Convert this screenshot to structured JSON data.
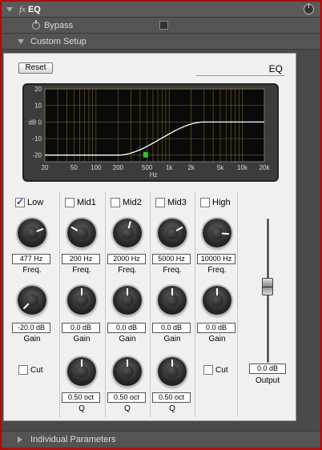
{
  "header": {
    "fx_label": "fx",
    "title": "EQ",
    "power_icon": "power-icon"
  },
  "bypass": {
    "label": "Bypass",
    "checked": false
  },
  "custom_setup": {
    "label": "Custom Setup"
  },
  "panel": {
    "reset_label": "Reset",
    "title": "EQ",
    "graph": {
      "y_ticks": [
        "20",
        "10",
        "dB 0",
        "-10",
        "-20"
      ],
      "x_ticks": [
        "20",
        "50",
        "100",
        "200",
        "500",
        "1k",
        "2k",
        "5k",
        "10k",
        "20k"
      ],
      "x_unit": "Hz",
      "curve_color": "#ffffff",
      "grid_color": "#8a6a2a",
      "handle_color": "#22cc22"
    },
    "bands": [
      {
        "id": "low",
        "label": "Low",
        "checked": true,
        "freq": "477 Hz",
        "freq_label": "Freq.",
        "gain": "-20.0 dB",
        "gain_label": "Gain",
        "cut_label": "Cut",
        "cut_checked": false
      },
      {
        "id": "mid1",
        "label": "Mid1",
        "checked": false,
        "freq": "200 Hz",
        "freq_label": "Freq.",
        "gain": "0.0 dB",
        "gain_label": "Gain",
        "q": "0.50 oct",
        "q_label": "Q"
      },
      {
        "id": "mid2",
        "label": "Mid2",
        "checked": false,
        "freq": "2000 Hz",
        "freq_label": "Freq.",
        "gain": "0.0 dB",
        "gain_label": "Gain",
        "q": "0.50 oct",
        "q_label": "Q"
      },
      {
        "id": "mid3",
        "label": "Mid3",
        "checked": false,
        "freq": "5000 Hz",
        "freq_label": "Freq.",
        "gain": "0.0 dB",
        "gain_label": "Gain",
        "q": "0.50 oct",
        "q_label": "Q"
      },
      {
        "id": "high",
        "label": "High",
        "checked": false,
        "freq": "10000 Hz",
        "freq_label": "Freq.",
        "gain": "0.0 dB",
        "gain_label": "Gain",
        "cut_label": "Cut",
        "cut_checked": false
      }
    ],
    "output": {
      "value": "0.0 dB",
      "label": "Output"
    }
  },
  "individual_parameters": {
    "label": "Individual Parameters"
  },
  "colors": {
    "accent_border": "#c00000",
    "panel_bg": "#f0f0f0",
    "host_bg": "#4a4a4a"
  }
}
